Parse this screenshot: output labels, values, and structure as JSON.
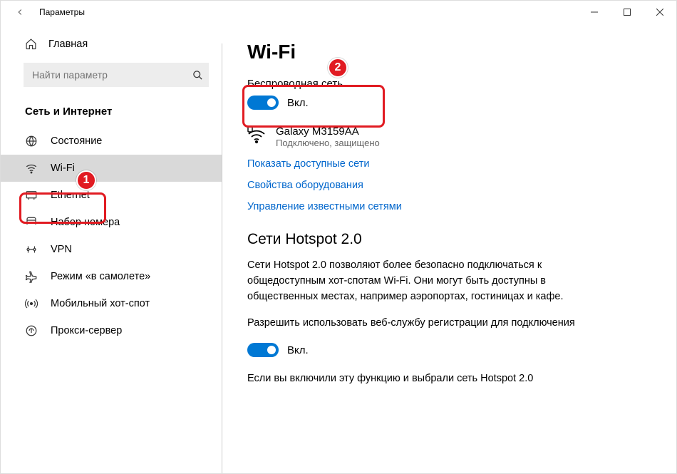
{
  "window": {
    "title": "Параметры"
  },
  "sidebar": {
    "home": "Главная",
    "search_placeholder": "Найти параметр",
    "section": "Сеть и Интернет",
    "items": [
      {
        "label": "Состояние",
        "icon": "status-icon"
      },
      {
        "label": "Wi-Fi",
        "icon": "wifi-icon",
        "selected": true
      },
      {
        "label": "Ethernet",
        "icon": "ethernet-icon"
      },
      {
        "label": "Набор номера",
        "icon": "dialup-icon"
      },
      {
        "label": "VPN",
        "icon": "vpn-icon"
      },
      {
        "label": "Режим «в самолете»",
        "icon": "airplane-icon"
      },
      {
        "label": "Мобильный хот-спот",
        "icon": "hotspot-icon"
      },
      {
        "label": "Прокси-сервер",
        "icon": "proxy-icon"
      }
    ]
  },
  "content": {
    "title": "Wi-Fi",
    "wireless": {
      "label": "Беспроводная сеть",
      "state": "Вкл."
    },
    "network": {
      "name": "Galaxy M3159AA",
      "status": "Подключено, защищено"
    },
    "links": {
      "show_networks": "Показать доступные сети",
      "hw_props": "Свойства оборудования",
      "manage_known": "Управление известными сетями"
    },
    "hotspot": {
      "title": "Сети Hotspot 2.0",
      "body": "Сети Hotspot 2.0 позволяют более безопасно подключаться к общедоступным хот-спотам Wi-Fi. Они могут быть доступны в общественных местах, например аэропортах, гостиницах и кафе.",
      "allow_label": "Разрешить использовать веб-службу регистрации для подключения",
      "state": "Вкл.",
      "cutoff": "Если вы включили эту функцию и выбрали сеть Hotspot 2.0"
    }
  },
  "callouts": {
    "one": "1",
    "two": "2"
  }
}
